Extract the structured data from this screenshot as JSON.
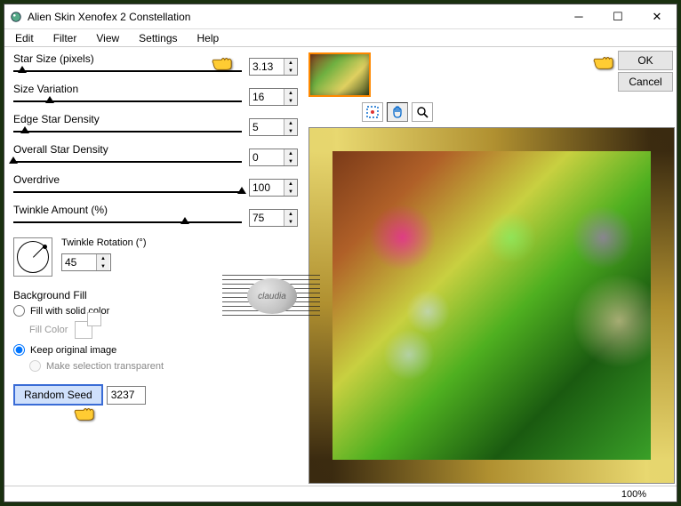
{
  "window": {
    "title": "Alien Skin Xenofex 2 Constellation"
  },
  "menu": {
    "edit": "Edit",
    "filter": "Filter",
    "view": "View",
    "settings": "Settings",
    "help": "Help"
  },
  "sliders": {
    "star_size": {
      "label": "Star Size (pixels)",
      "value": "3.13",
      "pos": 4
    },
    "size_var": {
      "label": "Size Variation",
      "value": "16",
      "pos": 16
    },
    "edge_dens": {
      "label": "Edge Star Density",
      "value": "5",
      "pos": 5
    },
    "overall": {
      "label": "Overall Star Density",
      "value": "0",
      "pos": 0
    },
    "overdrive": {
      "label": "Overdrive",
      "value": "100",
      "pos": 100
    },
    "twinkle_amt": {
      "label": "Twinkle Amount (%)",
      "value": "75",
      "pos": 75
    }
  },
  "twinkle_rotation": {
    "label": "Twinkle Rotation (°)",
    "value": "45"
  },
  "bg_fill": {
    "heading": "Background Fill",
    "opt_solid": "Fill with solid color",
    "fill_color_label": "Fill Color",
    "opt_keep": "Keep original image",
    "opt_trans": "Make selection transparent"
  },
  "seed": {
    "button": "Random Seed",
    "value": "3237"
  },
  "buttons": {
    "ok": "OK",
    "cancel": "Cancel"
  },
  "status": {
    "zoom": "100%"
  },
  "watermark": {
    "text": "claudia"
  }
}
